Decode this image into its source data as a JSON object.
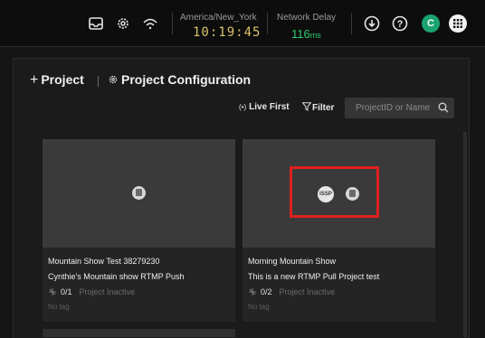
{
  "topbar": {
    "icons": [
      "inbox-icon",
      "settings-icon",
      "signal-icon"
    ],
    "timezone_label": "America/New_York",
    "clock": "10:19:45",
    "network_delay_label": "Network Delay",
    "network_delay_value": "116",
    "network_delay_unit": "ms",
    "right_icons": [
      "upload-icon",
      "help-icon"
    ],
    "avatar_initial": "C",
    "avatar_color": "#1aa36e"
  },
  "page": {
    "add_project_label": "Project",
    "config_label": "Project Configuration",
    "live_first_label": "Live First",
    "filter_label": "Filter",
    "search_placeholder": "ProjectID or Name"
  },
  "cards": [
    {
      "title": "Mountain Show Test 38279230",
      "description": "Cynthie's Mountain show RTMP Push",
      "count": "0/1",
      "status": "Project Inactive",
      "tag": "No tag"
    },
    {
      "title": "Morning Mountain Show",
      "description": "This is a new RTMP Pull Project test",
      "count": "0/2",
      "status": "Project Inactive",
      "tag": "No tag",
      "logo_text": "ISSP"
    }
  ],
  "colors": {
    "highlight": "#e02020",
    "delay": "#2ecc71",
    "clock": "#d8c06a"
  }
}
